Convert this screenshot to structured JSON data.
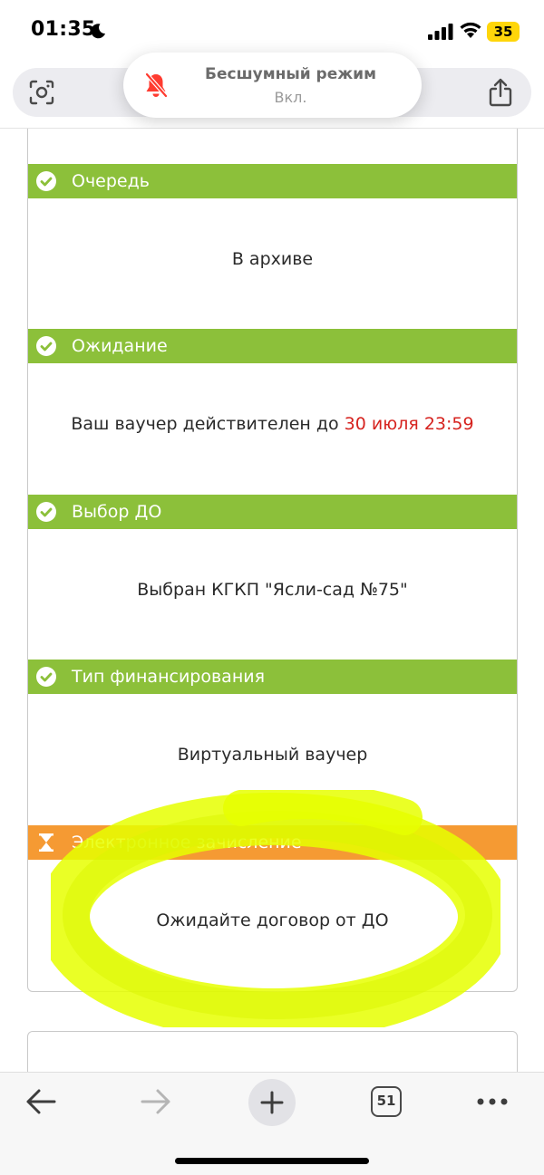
{
  "status_bar": {
    "time": "01:35",
    "battery": "35",
    "battery_color": "#ffd60a"
  },
  "toast": {
    "title": "Бесшумный режим",
    "subtitle": "Вкл.",
    "icon": "bell-slash-icon",
    "icon_color": "#ff3b30"
  },
  "colors": {
    "step_done": "#8cc03a",
    "step_pending": "#f59a33",
    "accent_red": "#d6231f",
    "highlighter": "#e6ff00"
  },
  "steps": [
    {
      "title": "Очередь",
      "status": "done",
      "icon": "check-circle-icon",
      "text": "В архиве"
    },
    {
      "title": "Ожидание",
      "status": "done",
      "icon": "check-circle-icon",
      "text": "Ваш ваучер действителен до ",
      "highlight": "30 июля 23:59"
    },
    {
      "title": "Выбор ДО",
      "status": "done",
      "icon": "check-circle-icon",
      "text": "Выбран КГКП \"Ясли-сад №75\""
    },
    {
      "title": "Тип финансирования",
      "status": "done",
      "icon": "check-circle-icon",
      "text": "Виртуальный ваучер"
    },
    {
      "title": "Электронное зачисление",
      "status": "pending",
      "icon": "hourglass-icon",
      "text": "Ожидайте договор от ДО"
    }
  ],
  "bottom_bar": {
    "tab_count": "51"
  }
}
